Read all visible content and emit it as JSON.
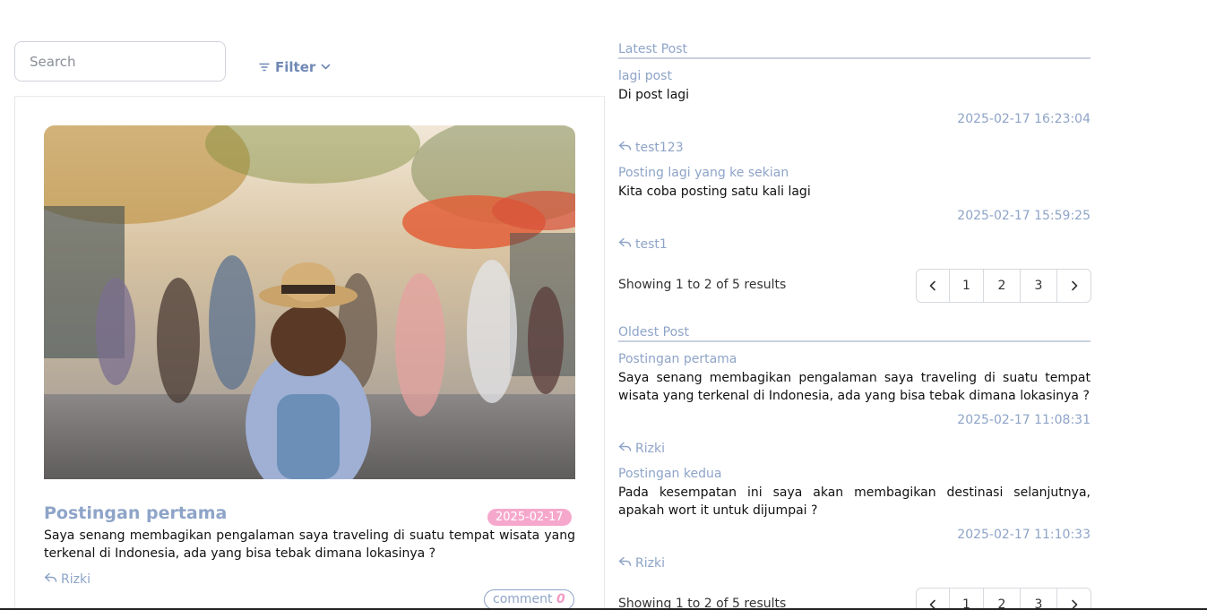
{
  "search": {
    "placeholder": "Search"
  },
  "filter": {
    "label": "Filter"
  },
  "feed": {
    "post": {
      "title": "Postingan pertama",
      "date": "2025-02-17",
      "body": "Saya senang membagikan pengalaman saya traveling di suatu tempat wisata yang terkenal di Indonesia, ada yang bisa tebak dimana lokasinya ?",
      "author": "Rizki",
      "comment_label": "comment",
      "comment_count": "0"
    }
  },
  "latest": {
    "title": "Latest Post",
    "items": [
      {
        "title": "lagi post",
        "body": "Di post lagi",
        "date": "2025-02-17 16:23:04",
        "author": "test123"
      },
      {
        "title": "Posting lagi yang ke sekian",
        "body": "Kita coba posting satu kali lagi",
        "date": "2025-02-17 15:59:25",
        "author": "test1"
      }
    ],
    "results": "Showing 1 to 2 of 5 results",
    "pages": [
      "1",
      "2",
      "3"
    ]
  },
  "oldest": {
    "title": "Oldest Post",
    "items": [
      {
        "title": "Postingan pertama",
        "body": "Saya senang membagikan pengalaman saya traveling di suatu tempat wisata yang terkenal di Indonesia, ada yang bisa tebak dimana lokasinya ?",
        "date": "2025-02-17 11:08:31",
        "author": "Rizki"
      },
      {
        "title": "Postingan kedua",
        "body": "Pada kesempatan ini saya akan membagikan destinasi selanjutnya, apakah wort it untuk dijumpai ?",
        "date": "2025-02-17 11:10:33",
        "author": "Rizki"
      }
    ],
    "results": "Showing 1 to 2 of 5 results",
    "pages": [
      "1",
      "2",
      "3"
    ]
  },
  "icons": {
    "filter": "filter-icon",
    "chevron": "chevron-down-icon",
    "reply": "reply-icon",
    "prev": "chevron-left-icon",
    "next": "chevron-right-icon"
  },
  "colors": {
    "accent": "#8ea4c8",
    "filter_text": "#7089b5",
    "badge": "#f6a8cc",
    "comment_count": "#f49ac5"
  }
}
